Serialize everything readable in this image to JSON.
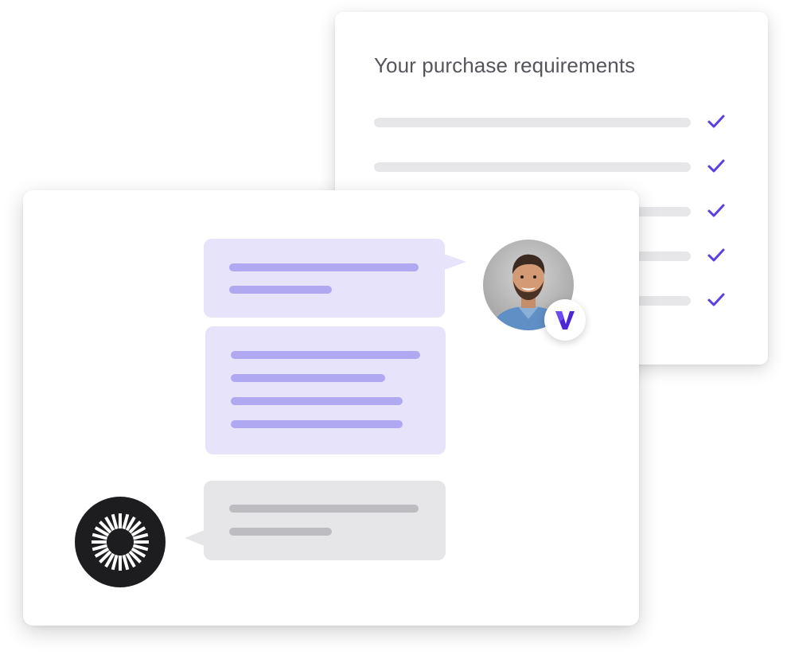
{
  "requirements_card": {
    "title": "Your purchase requirements",
    "items": [
      {
        "checked": true
      },
      {
        "checked": true
      },
      {
        "checked": true
      },
      {
        "checked": true
      },
      {
        "checked": true
      }
    ],
    "check_color": "#5b3fe0"
  },
  "chat": {
    "agent_avatar": "agent-photo",
    "agent_brand_badge": "v-logo-icon",
    "user_avatar": "sunburst-logo-icon",
    "messages": [
      {
        "from": "agent",
        "lines": 2
      },
      {
        "from": "agent",
        "lines": 4
      },
      {
        "from": "user",
        "lines": 2
      }
    ]
  },
  "colors": {
    "accent": "#5b3fe0",
    "agent_bubble": "#e6e3fb",
    "agent_line": "#b1a8f2",
    "user_bubble": "#e6e6e8",
    "user_line": "#bdbdc1",
    "placeholder_bar": "#e7e7ea"
  }
}
